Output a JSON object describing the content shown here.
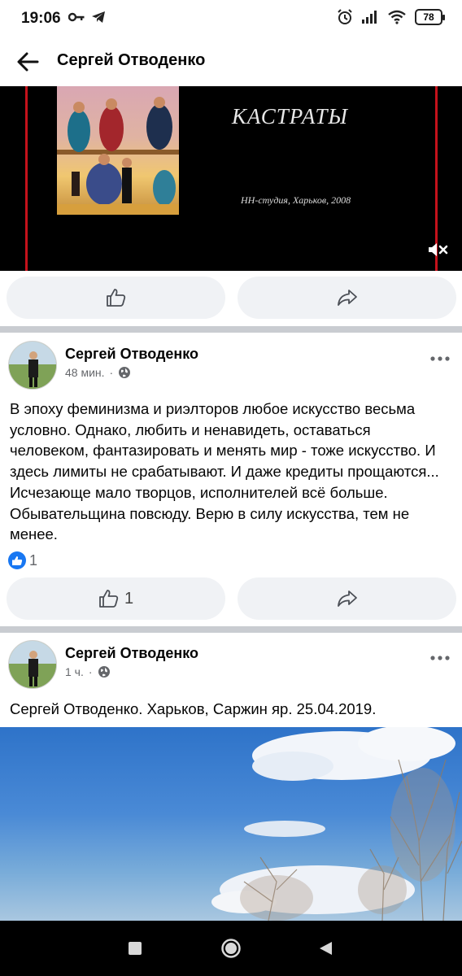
{
  "status_bar": {
    "time": "19:06",
    "battery": "78",
    "icons": [
      "key-icon",
      "telegram-icon",
      "alarm-icon",
      "signal-icon",
      "wifi-icon",
      "battery-icon"
    ]
  },
  "header": {
    "title": "Сергей Отводенко",
    "back_icon": "arrow-left-icon"
  },
  "video": {
    "title_text": "КАСТРАТЫ",
    "subtitle_text": "НН-студия, Харьков, 2008",
    "mute_icon": "volume-off-icon"
  },
  "posts": [
    {
      "author": "Сергей Отводенко",
      "time": "48 мин.",
      "privacy_icon": "globe-icon",
      "text": "В эпоху феминизма и риэлторов любое искусство весьма условно. Однако, любить и ненавидеть, оставаться человеком, фантазировать и менять мир - тоже искусство. И здесь лимиты не срабатывают. И даже кредиты прощаются... Исчезающе мало творцов, исполнителей всё больше. Обывательщина повсюду. Верю в силу искусства, тем не менее.",
      "reaction_count": "1",
      "like_count": "1"
    },
    {
      "author": "Сергей Отводенко",
      "time": "1 ч.",
      "privacy_icon": "globe-icon",
      "text": "Сергей Отводенко. Харьков, Саржин яр. 25.04.2019."
    }
  ],
  "colors": {
    "accent": "#1877f2",
    "button_bg": "#f0f2f5",
    "separator": "#c9ccd1",
    "meta_text": "#65676b"
  }
}
